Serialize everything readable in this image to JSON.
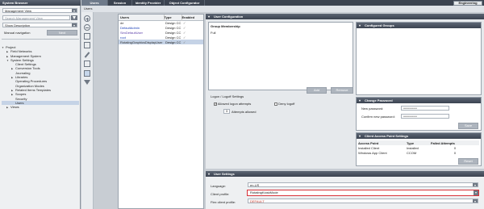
{
  "left": {
    "title": "System Browser",
    "view_select": "Management View",
    "search_placeholder": "Search Management View",
    "desc_select": "Show Description",
    "manual_nav": "Manual navigation",
    "manual_nav_button": "Next",
    "tree": [
      {
        "label": "Project",
        "level": 0,
        "toggle": "▼"
      },
      {
        "label": "Field Networks",
        "level": 1,
        "toggle": "▶"
      },
      {
        "label": "Management System",
        "level": 1,
        "toggle": "▶"
      },
      {
        "label": "System Settings",
        "level": 1,
        "toggle": "▼"
      },
      {
        "label": "Client Settings",
        "level": 2,
        "toggle": ""
      },
      {
        "label": "Conversion Tools",
        "level": 2,
        "toggle": "▶"
      },
      {
        "label": "Journaling",
        "level": 2,
        "toggle": ""
      },
      {
        "label": "Libraries",
        "level": 2,
        "toggle": "▶"
      },
      {
        "label": "Operating Procedures",
        "level": 2,
        "toggle": ""
      },
      {
        "label": "Organization Modes",
        "level": 2,
        "toggle": ""
      },
      {
        "label": "Related Items Templates",
        "level": 2,
        "toggle": "▶"
      },
      {
        "label": "Scopes",
        "level": 2,
        "toggle": "▶"
      },
      {
        "label": "Security",
        "level": 2,
        "toggle": ""
      },
      {
        "label": "Users",
        "level": 2,
        "toggle": "",
        "selected": true
      },
      {
        "label": "Views",
        "level": 1,
        "toggle": "▶"
      }
    ]
  },
  "tabs": {
    "items": [
      "Users",
      "Session",
      "Identity Provider",
      "Object Configurator"
    ],
    "active_index": 0,
    "mode_button": "Engineering"
  },
  "breadcrumb": "Users",
  "users_table": {
    "headers": [
      "Users",
      "Type",
      "Enabled"
    ],
    "rows": [
      {
        "name": "de",
        "type": "Design CC",
        "enabled": "✓",
        "color": "#333333"
      },
      {
        "name": "DefaultAdmin",
        "type": "Design CC",
        "enabled": "✓",
        "color": "#1a3fb8"
      },
      {
        "name": "SimDefaultUser",
        "type": "Design CC",
        "enabled": "✓",
        "color": "#5b3fa8"
      },
      {
        "name": "root",
        "type": "Design CC",
        "enabled": "✓",
        "color": "#1a3fb8"
      },
      {
        "name": "RotatingGraphicsDisplayUser",
        "type": "Design CC",
        "enabled": "✓",
        "color": "#333333",
        "selected": true
      }
    ]
  },
  "user_config": {
    "header": "User Configuration",
    "group_membership": {
      "title": "Group Membership",
      "items": [
        "Full"
      ],
      "add": "Add",
      "remove": "Remove"
    },
    "configured_groups": {
      "title": "Configured Groups"
    },
    "logon": {
      "title": "Logon / Logoff Settings",
      "allowed_attempts_label": "Allowed logon attempts",
      "allowed_attempts_checked": "✓",
      "deny_logoff_label": "Deny logoff",
      "attempts_value": "3",
      "attempts_label": "Attempts allowed"
    },
    "change_password": {
      "title": "Change Password",
      "new_label": "New password:",
      "new_value": "••••••••••••••••",
      "confirm_label": "Confirm new password:",
      "confirm_value": "••••••••••••••••",
      "save": "Save"
    },
    "client_access": {
      "title": "Client Access Point Settings",
      "headers": [
        "Access Point",
        "Type",
        "Failed Attempts"
      ],
      "rows": [
        [
          "Installed Client",
          "Installed",
          "0"
        ],
        [
          "Windows App Client",
          "CCOM",
          "0"
        ]
      ],
      "reset": "Reset"
    }
  },
  "user_settings": {
    "header": "User Settings",
    "language_label": "Language:",
    "language_value": "en-US",
    "client_profile_label": "Client profile:",
    "client_profile_value": "RotatingKioskMode",
    "flex_profile_label": "Flex client profile:",
    "flex_profile_value": "DEFAULT"
  },
  "colors": {
    "selected_row": "#c5d3e6",
    "highlight_border": "#d9333a",
    "flex_value": "#c0392b"
  }
}
